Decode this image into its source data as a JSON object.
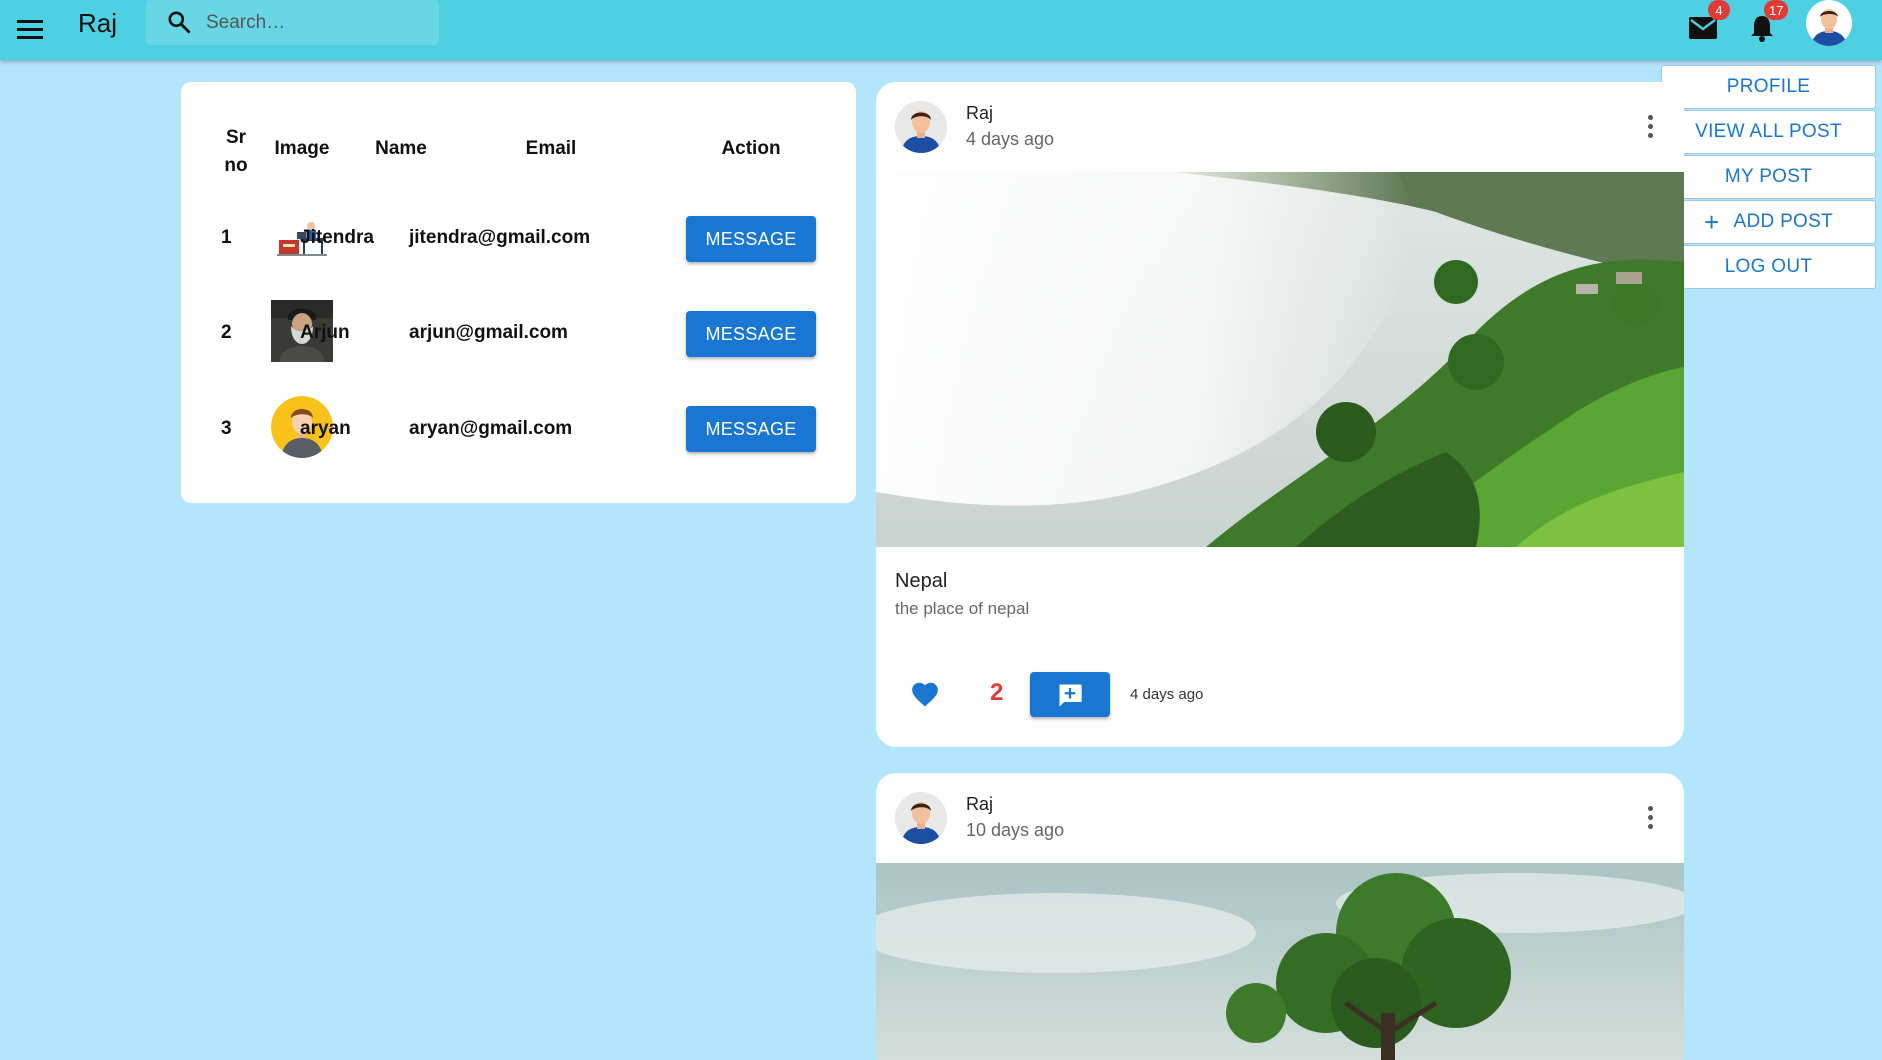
{
  "header": {
    "title": "Raj",
    "search_placeholder": "Search…",
    "mail_badge": "4",
    "notification_badge": "17"
  },
  "menu": {
    "items": [
      "PROFILE",
      "VIEW ALL POST",
      "MY POST",
      "ADD POST",
      "LOG OUT"
    ]
  },
  "users_table": {
    "headers": [
      "Sr no",
      "Image",
      "Name",
      "Email",
      "Action"
    ],
    "rows": [
      {
        "sr": "1",
        "name": "Jitendra",
        "email": "jitendra@gmail.com",
        "action": "MESSAGE"
      },
      {
        "sr": "2",
        "name": "Arjun",
        "email": "arjun@gmail.com",
        "action": "MESSAGE"
      },
      {
        "sr": "3",
        "name": "aryan",
        "email": "aryan@gmail.com",
        "action": "MESSAGE"
      }
    ]
  },
  "posts": [
    {
      "author": "Raj",
      "time": "4 days ago",
      "title": "Nepal",
      "description": "the place of nepal",
      "likes": "2",
      "footer_time": "4 days ago"
    },
    {
      "author": "Raj",
      "time": "10 days ago"
    }
  ],
  "colors": {
    "appbar": "#4dd0e1",
    "background": "#b3e5fc",
    "primary": "#1976d2",
    "badge": "#e53935"
  }
}
